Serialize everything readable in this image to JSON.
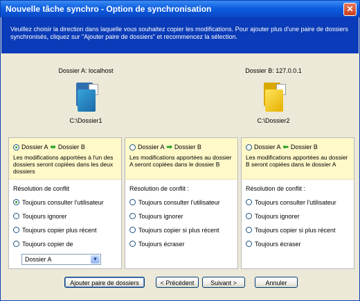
{
  "window": {
    "title": "Nouvelle tâche synchro - Option de synchronisation",
    "close_glyph": "✕"
  },
  "header": {
    "description": "Veuillez choisir la direction dans laquelle vous souhaitez copier les modifications. Pour ajouter plus d'une paire de dossiers synchronisés, cliquez sur \"Ajouter paire de dossiers\" et recommencez la sélection."
  },
  "folders": {
    "a": {
      "label": "Dossier A: localhost",
      "path": "C:\\Dossier1",
      "icon": "folder-blue-icon"
    },
    "b": {
      "label": "Dossier B: 127.0.0.1",
      "path": "C:\\Dossier2",
      "icon": "folder-yellow-icon"
    }
  },
  "panels": [
    {
      "selected": true,
      "from": "Dossier A",
      "arrow": "⬌",
      "to": "Dossier B",
      "description": "Les modifications apportées à l'un des dossiers seront copiées dans les deux dossiers",
      "conflict_title": "Résolution de conflit",
      "options": [
        {
          "label": "Toujours consulter l'utilisateur",
          "checked": true
        },
        {
          "label": "Toujours ignorer",
          "checked": false
        },
        {
          "label": "Toujours copier plus récent",
          "checked": false
        },
        {
          "label": "Toujours copier de",
          "checked": false
        }
      ],
      "dropdown_value": "Dossier A"
    },
    {
      "selected": false,
      "from": "Dossier A",
      "arrow": "➡",
      "to": "Dossier B",
      "description": "Les modifications apportées au dossier A seront copiées dans le dossier B",
      "conflict_title": "Résolution de conflit :",
      "options": [
        {
          "label": "Toujours consulter l'utilisateur",
          "checked": false
        },
        {
          "label": "Toujours ignorer",
          "checked": false
        },
        {
          "label": "Toujours copier si plus récent",
          "checked": false
        },
        {
          "label": "Toujours écraser",
          "checked": false
        }
      ]
    },
    {
      "selected": false,
      "from": "Dossier A",
      "arrow": "⬅",
      "to": "Dossier B",
      "description": "Les modifications apportées au dossier B seront copiées dans le dossier A",
      "conflict_title": "Résolution de conflit :",
      "options": [
        {
          "label": "Toujours consulter l'utilisateur",
          "checked": false
        },
        {
          "label": "Toujours ignorer",
          "checked": false
        },
        {
          "label": "Toujours copier si plus récent",
          "checked": false
        },
        {
          "label": "Toujours écraser",
          "checked": false
        }
      ]
    }
  ],
  "buttons": {
    "add_pair": "Ajouter paire de dossiers",
    "previous": "< Précédent",
    "next": "Suivant >",
    "cancel": "Annuler"
  },
  "colors": {
    "title_bar": "#0e5ee0",
    "header_band": "#0a3bb8",
    "panel_head": "#fff8c9",
    "arrow_green": "#21a121"
  }
}
